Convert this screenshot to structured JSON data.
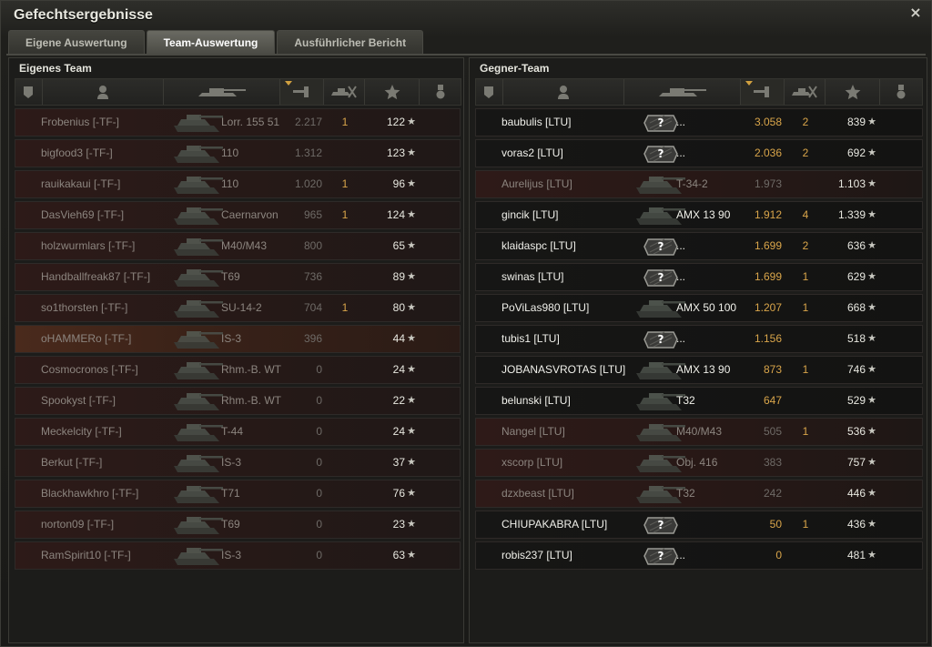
{
  "window": {
    "title": "Gefechtsergebnisse",
    "close_label": "×"
  },
  "tabs": [
    {
      "label": "Eigene Auswertung",
      "active": false
    },
    {
      "label": "Team-Auswertung",
      "active": true
    },
    {
      "label": "Ausführlicher Bericht",
      "active": false
    }
  ],
  "icons": {
    "squad": "squad-badge-icon",
    "player": "player-icon",
    "tank": "tank-icon",
    "damage": "damage-icon",
    "kills": "kills-icon",
    "xp": "star-icon",
    "medal": "medal-icon",
    "row_star": "★",
    "unknown_vehicle": "?"
  },
  "colors": {
    "accent": "#d9a54a",
    "row_dead": "#2b1817",
    "row_self": "#4a2a1c",
    "text": "#f0f0ea",
    "text_dead": "#8c857f"
  },
  "own_team": {
    "title": "Eigenes Team",
    "players": [
      {
        "name": "Frobenius [-TF-]",
        "vehicle": "Lorr. 155 51",
        "damage": "2.217",
        "kills": "1",
        "xp": "122",
        "dead": true
      },
      {
        "name": "bigfood3 [-TF-]",
        "vehicle": "110",
        "damage": "1.312",
        "kills": "",
        "xp": "123",
        "dead": true
      },
      {
        "name": "rauikakaui [-TF-]",
        "vehicle": "110",
        "damage": "1.020",
        "kills": "1",
        "xp": "96",
        "dead": true
      },
      {
        "name": "DasVieh69 [-TF-]",
        "vehicle": "Caernarvon",
        "damage": "965",
        "kills": "1",
        "xp": "124",
        "dead": true
      },
      {
        "name": "holzwurmlars [-TF-]",
        "vehicle": "M40/M43",
        "damage": "800",
        "kills": "",
        "xp": "65",
        "dead": true
      },
      {
        "name": "Handballfreak87 [-TF-]",
        "vehicle": "T69",
        "damage": "736",
        "kills": "",
        "xp": "89",
        "dead": true
      },
      {
        "name": "so1thorsten [-TF-]",
        "vehicle": "SU-14-2",
        "damage": "704",
        "kills": "1",
        "xp": "80",
        "dead": true
      },
      {
        "name": "oHAMMERo [-TF-]",
        "vehicle": "IS-3",
        "damage": "396",
        "kills": "",
        "xp": "44",
        "dead": true,
        "self": true
      },
      {
        "name": "Cosmocronos [-TF-]",
        "vehicle": "Rhm.-B. WT",
        "damage": "0",
        "kills": "",
        "xp": "24",
        "dead": true
      },
      {
        "name": "Spookyst [-TF-]",
        "vehicle": "Rhm.-B. WT",
        "damage": "0",
        "kills": "",
        "xp": "22",
        "dead": true
      },
      {
        "name": "Meckelcity [-TF-]",
        "vehicle": "T-44",
        "damage": "0",
        "kills": "",
        "xp": "24",
        "dead": true
      },
      {
        "name": "Berkut [-TF-]",
        "vehicle": "IS-3",
        "damage": "0",
        "kills": "",
        "xp": "37",
        "dead": true
      },
      {
        "name": "Blackhawkhro [-TF-]",
        "vehicle": "T71",
        "damage": "0",
        "kills": "",
        "xp": "76",
        "dead": true
      },
      {
        "name": "norton09 [-TF-]",
        "vehicle": "T69",
        "damage": "0",
        "kills": "",
        "xp": "23",
        "dead": true
      },
      {
        "name": "RamSpirit10 [-TF-]",
        "vehicle": "IS-3",
        "damage": "0",
        "kills": "",
        "xp": "63",
        "dead": true
      }
    ]
  },
  "enemy_team": {
    "title": "Gegner-Team",
    "players": [
      {
        "name": "baubulis [LTU]",
        "vehicle": "...",
        "damage": "3.058",
        "kills": "2",
        "xp": "839",
        "dead": false,
        "unknown": true
      },
      {
        "name": "voras2 [LTU]",
        "vehicle": "...",
        "damage": "2.036",
        "kills": "2",
        "xp": "692",
        "dead": false,
        "unknown": true
      },
      {
        "name": "Aurelijus [LTU]",
        "vehicle": "T-34-2",
        "damage": "1.973",
        "kills": "",
        "xp": "1.103",
        "dead": true,
        "unknown": false
      },
      {
        "name": "gincik [LTU]",
        "vehicle": "AMX 13 90",
        "damage": "1.912",
        "kills": "4",
        "xp": "1.339",
        "dead": false,
        "unknown": false
      },
      {
        "name": "klaidaspc [LTU]",
        "vehicle": "...",
        "damage": "1.699",
        "kills": "2",
        "xp": "636",
        "dead": false,
        "unknown": true
      },
      {
        "name": "swinas [LTU]",
        "vehicle": "...",
        "damage": "1.699",
        "kills": "1",
        "xp": "629",
        "dead": false,
        "unknown": true
      },
      {
        "name": "PoViLas980 [LTU]",
        "vehicle": "AMX 50 100",
        "damage": "1.207",
        "kills": "1",
        "xp": "668",
        "dead": false,
        "unknown": false
      },
      {
        "name": "tubis1 [LTU]",
        "vehicle": "...",
        "damage": "1.156",
        "kills": "",
        "xp": "518",
        "dead": false,
        "unknown": true
      },
      {
        "name": "JOBANASVROTAS [LTU]",
        "vehicle": "AMX 13 90",
        "damage": "873",
        "kills": "1",
        "xp": "746",
        "dead": false,
        "unknown": false
      },
      {
        "name": "belunski [LTU]",
        "vehicle": "T32",
        "damage": "647",
        "kills": "",
        "xp": "529",
        "dead": false,
        "unknown": false
      },
      {
        "name": "Nangel [LTU]",
        "vehicle": "M40/M43",
        "damage": "505",
        "kills": "1",
        "xp": "536",
        "dead": true,
        "unknown": false
      },
      {
        "name": "xscorp [LTU]",
        "vehicle": "Obj. 416",
        "damage": "383",
        "kills": "",
        "xp": "757",
        "dead": true,
        "unknown": false
      },
      {
        "name": "dzxbeast [LTU]",
        "vehicle": "T32",
        "damage": "242",
        "kills": "",
        "xp": "446",
        "dead": true,
        "unknown": false
      },
      {
        "name": "CHIUPAKABRA [LTU]",
        "vehicle": "",
        "damage": "50",
        "kills": "1",
        "xp": "436",
        "dead": false,
        "unknown": true
      },
      {
        "name": "robis237 [LTU]",
        "vehicle": "...",
        "damage": "0",
        "kills": "",
        "xp": "481",
        "dead": false,
        "unknown": true
      }
    ]
  }
}
